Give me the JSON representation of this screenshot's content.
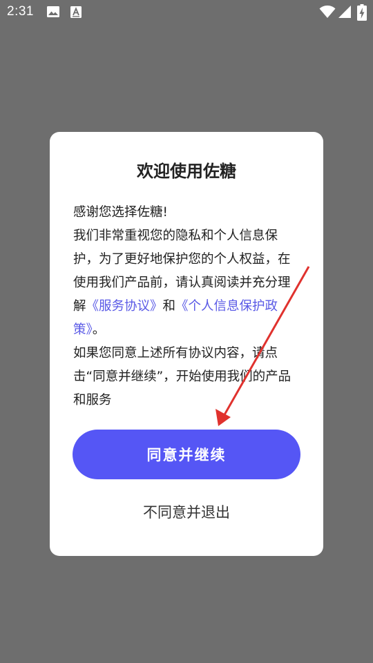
{
  "status_bar": {
    "time": "2:31"
  },
  "dialog": {
    "title": "欢迎使用佐糖",
    "greeting": "感谢您选择佐糖!",
    "body_before_links": "我们非常重视您的隐私和个人信息保护，为了更好地保护您的个人权益，在使用我们产品前，请认真阅读并充分理解",
    "service_agreement_link": "《服务协议》",
    "link_joiner": "和",
    "privacy_policy_link": "《个人信息保护政策》",
    "body_after_links": "。",
    "consent_text": "如果您同意上述所有协议内容，请点击“同意并继续”，开始使用我们的产品和服务",
    "agree_button_label": "同意并继续",
    "disagree_label": "不同意并退出"
  },
  "colors": {
    "backdrop": "#6e6e6e",
    "accent": "#5556f5",
    "link": "#5a5ae6",
    "annotation_arrow": "#e0322e"
  },
  "icons": {
    "status_left": [
      "image-icon",
      "font-a-icon"
    ],
    "status_right": [
      "wifi-icon",
      "signal-icon",
      "battery-charging-icon"
    ]
  }
}
